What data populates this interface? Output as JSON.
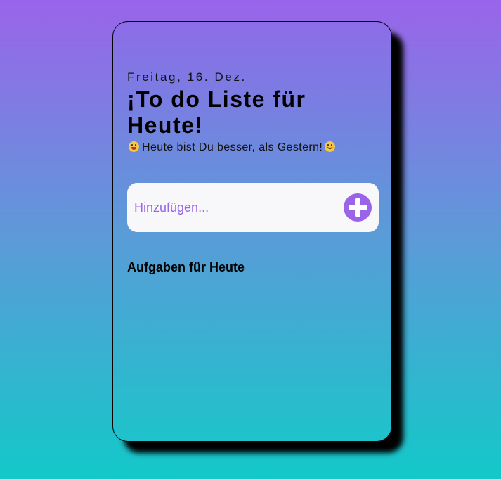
{
  "header": {
    "date": "Freitag, 16. Dez.",
    "title": "¡To do Liste für Heute!",
    "subtitle": "Heute bist Du besser, als Gestern!"
  },
  "add_task": {
    "placeholder": "Hinzufügen...",
    "button_icon": "plus-icon"
  },
  "tasks": {
    "section_title": "Aufgaben für Heute",
    "items": []
  },
  "colors": {
    "accent": "#9b63ea",
    "background_top": "#9a64ea",
    "background_bottom": "#12c9c8",
    "input_background": "#f8f8fa"
  }
}
